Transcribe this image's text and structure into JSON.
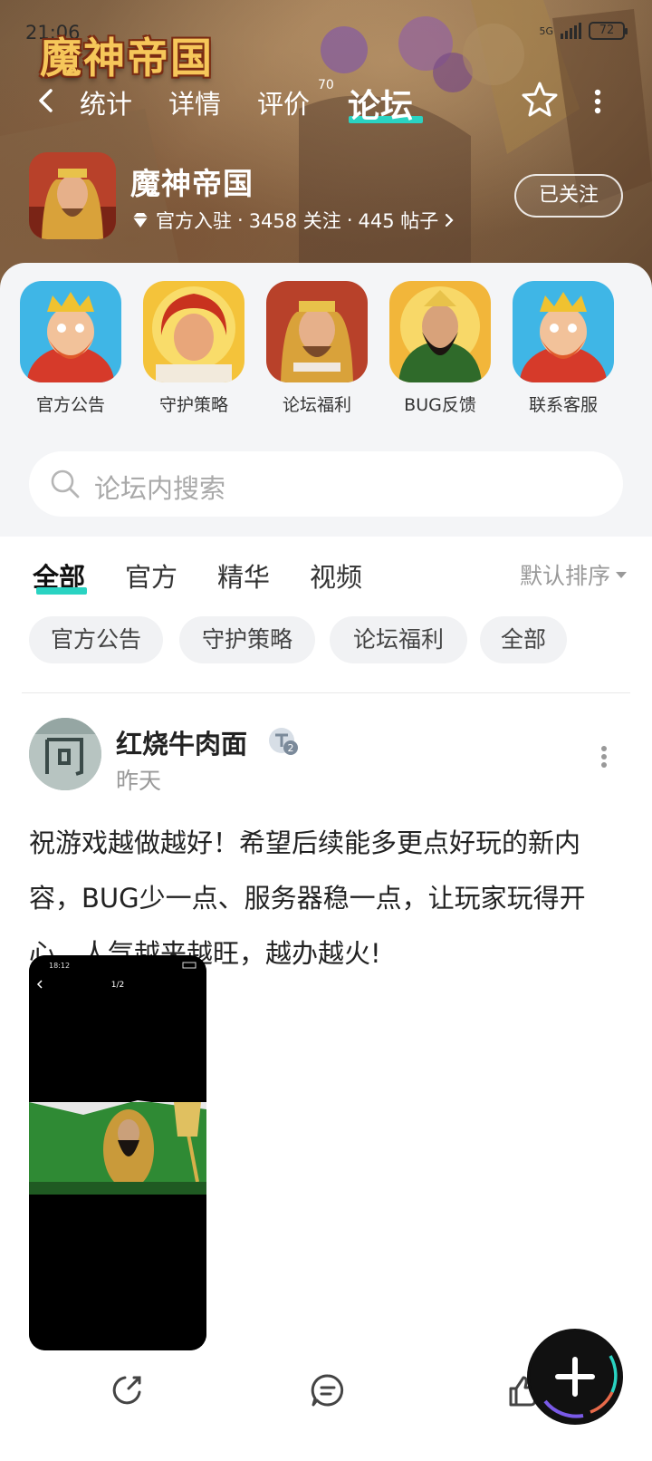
{
  "status_bar": {
    "time": "21:06",
    "network": "5G",
    "battery": "72"
  },
  "header": {
    "logo_text": "魔神帝国",
    "nav_tabs": [
      {
        "label": "统计"
      },
      {
        "label": "详情"
      },
      {
        "label": "评价",
        "badge": "70"
      },
      {
        "label": "论坛",
        "active": true
      }
    ]
  },
  "game": {
    "title": "魔神帝国",
    "official": "官方入驻",
    "followers": "3458 关注",
    "posts": "445 帖子",
    "follow_button": "已关注"
  },
  "shortcuts": [
    {
      "label": "官方公告",
      "icon": "king-avatar-icon"
    },
    {
      "label": "守护策略",
      "icon": "hero-avatar-icon"
    },
    {
      "label": "论坛福利",
      "icon": "game-avatar-icon"
    },
    {
      "label": "BUG反馈",
      "icon": "general-avatar-icon"
    },
    {
      "label": "联系客服",
      "icon": "king-avatar-icon"
    }
  ],
  "search": {
    "placeholder": "论坛内搜索"
  },
  "tabs": [
    {
      "label": "全部",
      "active": true
    },
    {
      "label": "官方"
    },
    {
      "label": "精华"
    },
    {
      "label": "视频"
    }
  ],
  "sort_label": "默认排序",
  "chips": [
    "官方公告",
    "守护策略",
    "论坛福利",
    "全部"
  ],
  "post": {
    "author": "红烧牛肉面",
    "time": "昨天",
    "content": "祝游戏越做越好！希望后续能多更点好玩的新内容，BUG少一点、服务器稳一点，让玩家玩得开心，人气越来越旺，越办越火!",
    "image_page": "1/2",
    "image_time": "18:12"
  },
  "colors": {
    "accent": "#2ad3c2",
    "fab": "#111111"
  }
}
